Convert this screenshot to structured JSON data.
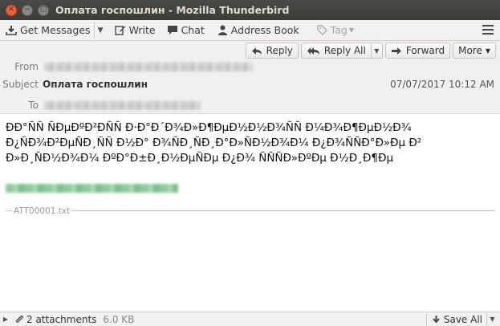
{
  "window": {
    "title": "Оплата госпошлин - Mozilla Thunderbird"
  },
  "toolbar": {
    "get_messages": "Get Messages",
    "write": "Write",
    "chat": "Chat",
    "address_book": "Address Book",
    "tag": "Tag"
  },
  "header": {
    "buttons": {
      "reply": "Reply",
      "reply_all": "Reply All",
      "forward": "Forward",
      "more": "More"
    },
    "from_label": "From",
    "subject_label": "Subject",
    "to_label": "To",
    "subject": "Оплата госпошлин",
    "date": "07/07/2017 10:12 AM"
  },
  "body": {
    "line1": "ÐÐ°ÑÑ ÑÐµÐºÐ²ÐÑÑ Ð·Ð°Ð´Ð¾Ð»Ð¶ÐµÐ½Ð½Ð¾ÑÑ Ð¼Ð¾Ð¶ÐµÐ½Ð¾",
    "line2": "Ð¿ÑÐ¾Ð²ÐµÑÐ¸ÑÑ  Ð½Ð° Ð¾ÑÐ¸ÑÐ¸Ð°Ð»ÑÐ½Ð¾Ð¼ Ð¿Ð¾ÑÑÐ°Ð»Ðµ  Ð²",
    "line3": "Ð»Ð¸ÑÐ½Ð¾Ð¼ ÐºÐ°Ð±Ð¸Ð½ÐµÑÐµ Ð¿Ð¾ ÑÑÑÐ»ÐºÐµ Ð½Ð¸Ð¶Ðµ"
  },
  "attachment_separator": "ATT00001.txt",
  "attachments": {
    "count_label": "2 attachments",
    "size": "6.0 KB",
    "save_all": "Save All"
  }
}
